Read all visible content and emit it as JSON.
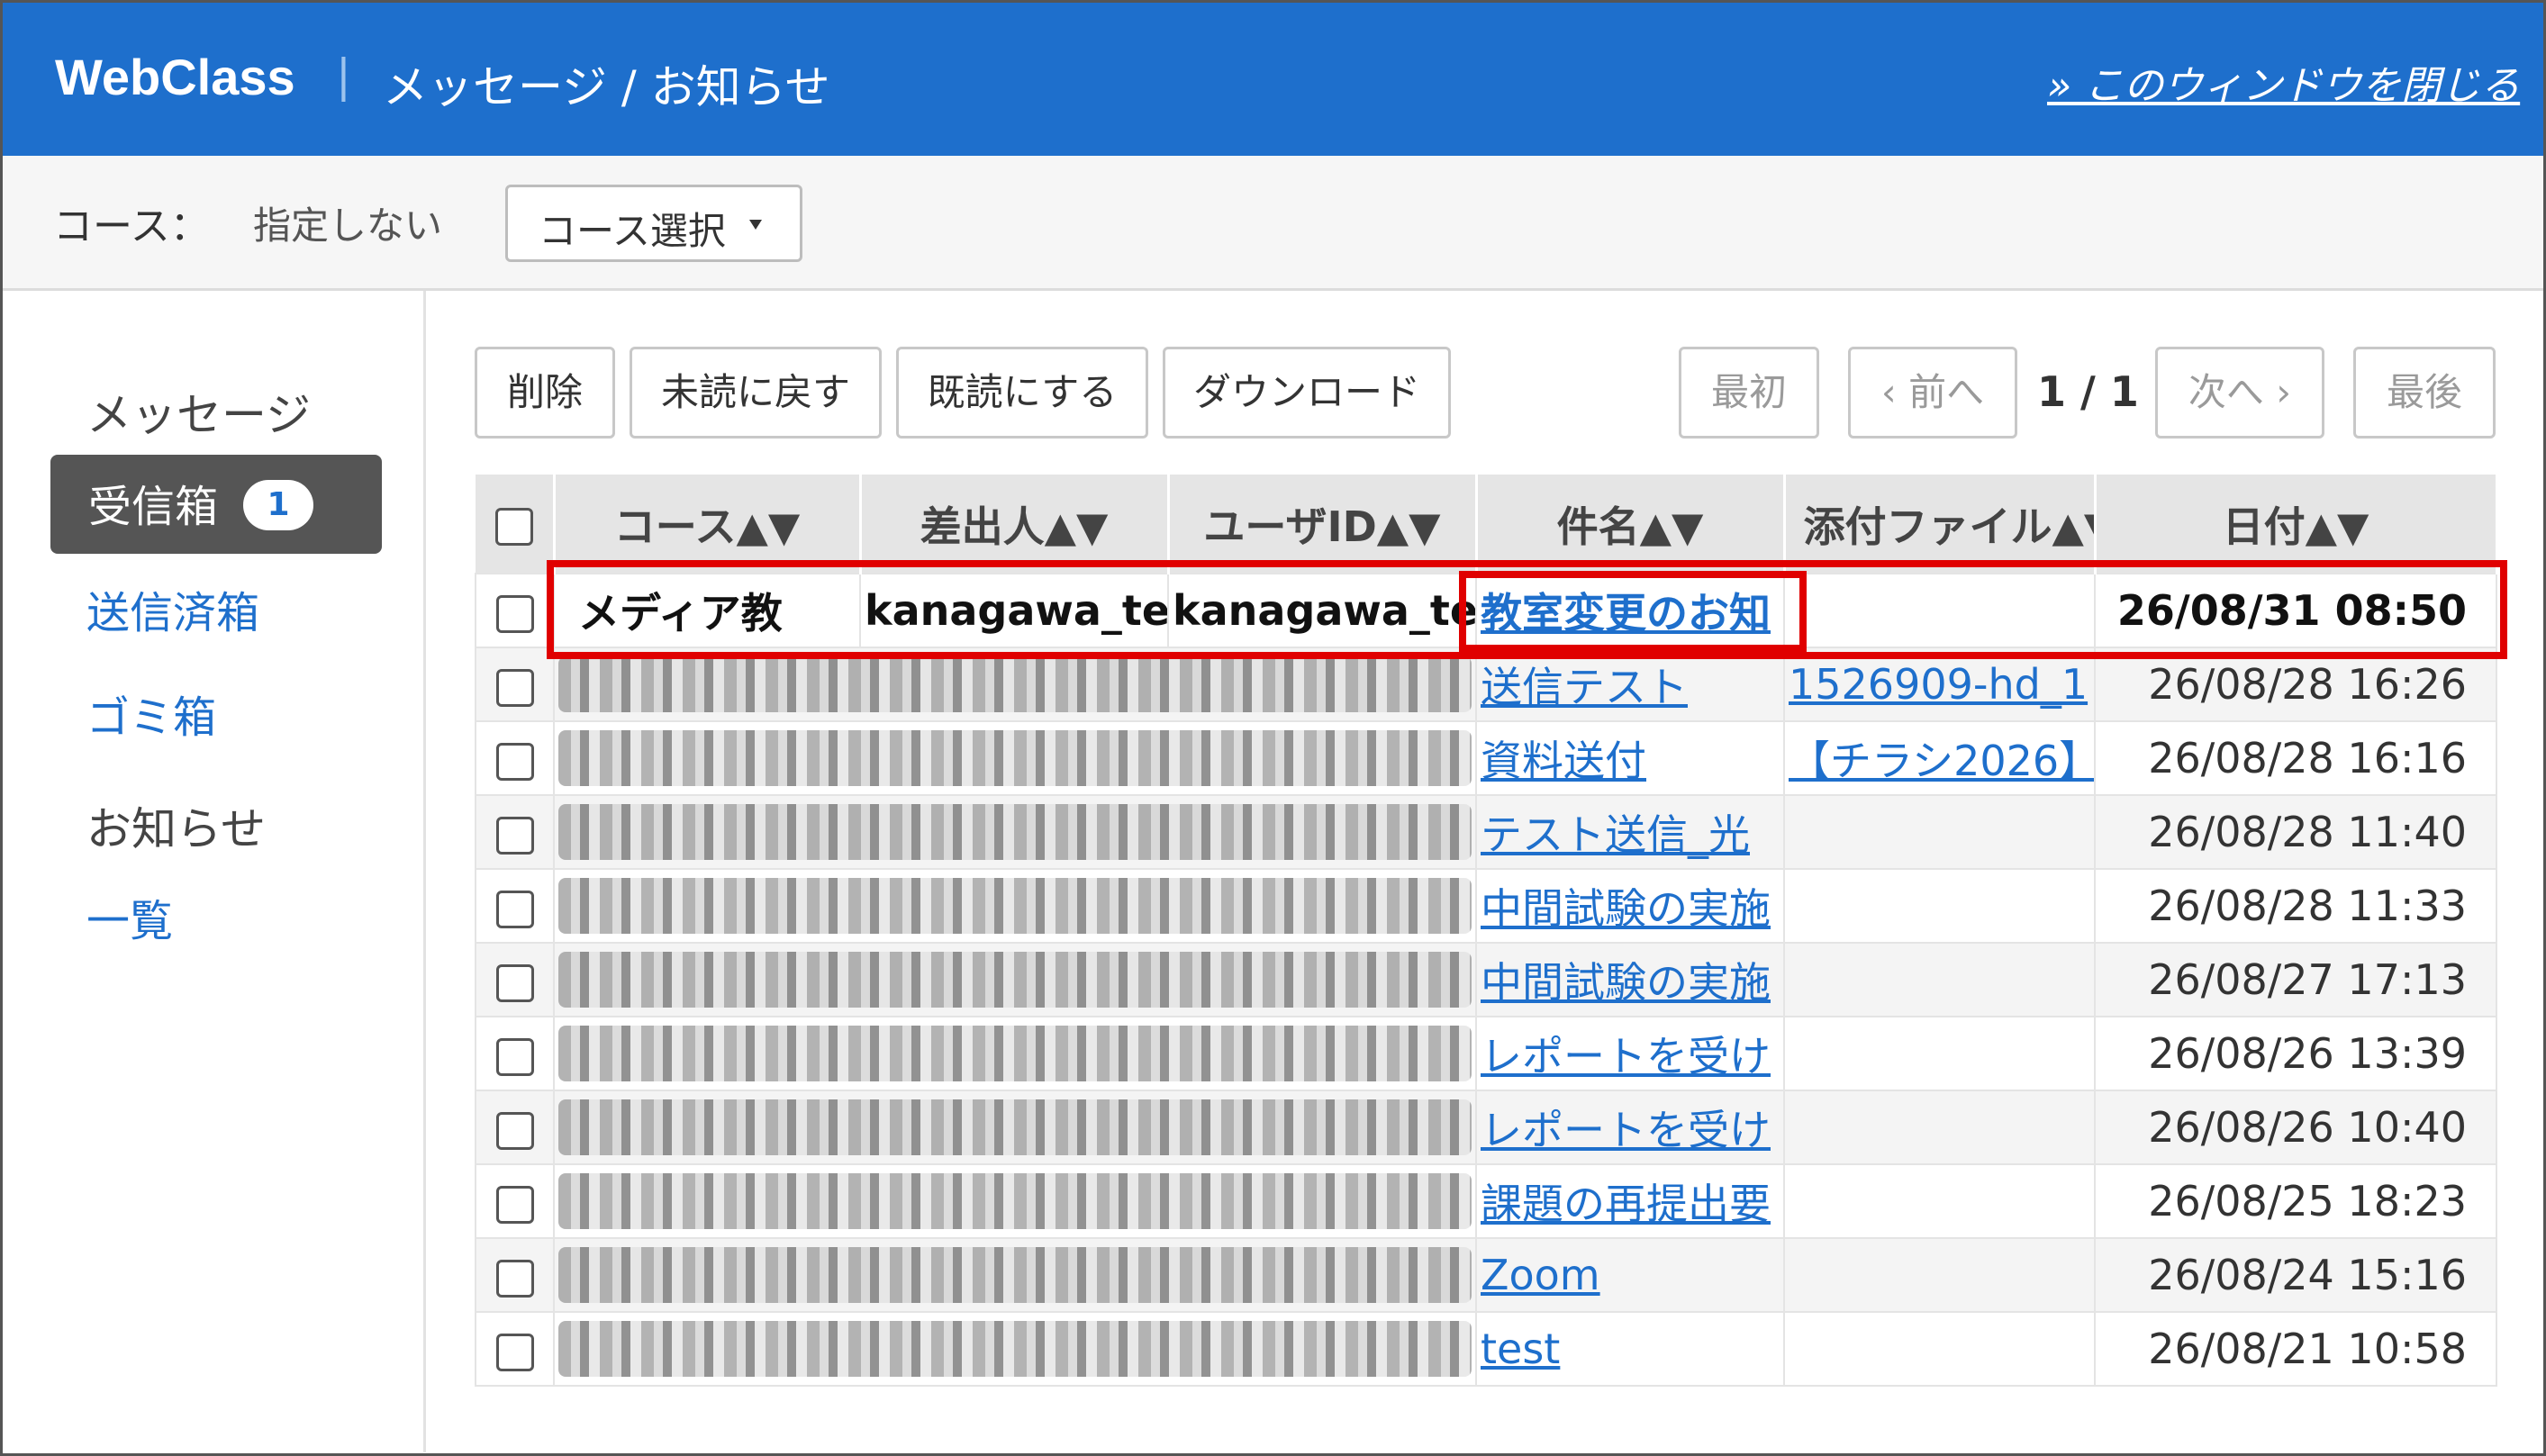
{
  "header": {
    "brand": "WebClass",
    "separator": "|",
    "title": "メッセージ / お知らせ",
    "close_link": "» このウィンドウを閉じる"
  },
  "course_bar": {
    "label": "コース：",
    "value": "指定しない",
    "select_button": "コース選択"
  },
  "sidebar": {
    "message_heading": "メッセージ",
    "inbox": "受信箱",
    "inbox_count": "1",
    "sent": "送信済箱",
    "trash": "ゴミ箱",
    "notice_heading": "お知らせ",
    "list": "一覧"
  },
  "toolbar": {
    "delete": "削除",
    "mark_unread": "未読に戻す",
    "mark_read": "既読にする",
    "download": "ダウンロード",
    "first": "最初",
    "prev": "‹ 前へ",
    "page_info": "1 / 1",
    "next": "次へ ›",
    "last": "最後"
  },
  "table": {
    "headers": {
      "course": "コース▲▼",
      "sender": "差出人▲▼",
      "userid": "ユーザID▲▼",
      "subject": "件名▲▼",
      "attachment": "添付ファイル▲▼",
      "date": "日付▲▼"
    },
    "rows": [
      {
        "course": "メディア教",
        "sender": "kanagawa_te",
        "userid": "kanagawa_te",
        "subject": "教室変更のお知",
        "attachment": "",
        "date": "26/08/31 08:50",
        "unread": true
      },
      {
        "subject": "送信テスト",
        "attachment": "1526909-hd_1",
        "date": "26/08/28 16:26"
      },
      {
        "subject": "資料送付",
        "attachment": "【チラシ2026】",
        "date": "26/08/28 16:16"
      },
      {
        "subject": "テスト送信_光",
        "attachment": "",
        "date": "26/08/28 11:40"
      },
      {
        "subject": "中間試験の実施",
        "attachment": "",
        "date": "26/08/28 11:33"
      },
      {
        "subject": "中間試験の実施",
        "attachment": "",
        "date": "26/08/27 17:13"
      },
      {
        "subject": "レポートを受け",
        "attachment": "",
        "date": "26/08/26 13:39"
      },
      {
        "subject": "レポートを受け",
        "attachment": "",
        "date": "26/08/26 10:40"
      },
      {
        "subject": "課題の再提出要",
        "attachment": "",
        "date": "26/08/25 18:23"
      },
      {
        "subject": "Zoom",
        "attachment": "",
        "date": "26/08/24 15:16"
      },
      {
        "subject": "test",
        "attachment": "",
        "date": "26/08/21 10:58"
      }
    ]
  },
  "colors": {
    "header_bg": "#1e6fcc",
    "link": "#1e6fcc",
    "highlight": "#e00000",
    "active_nav": "#555555"
  }
}
